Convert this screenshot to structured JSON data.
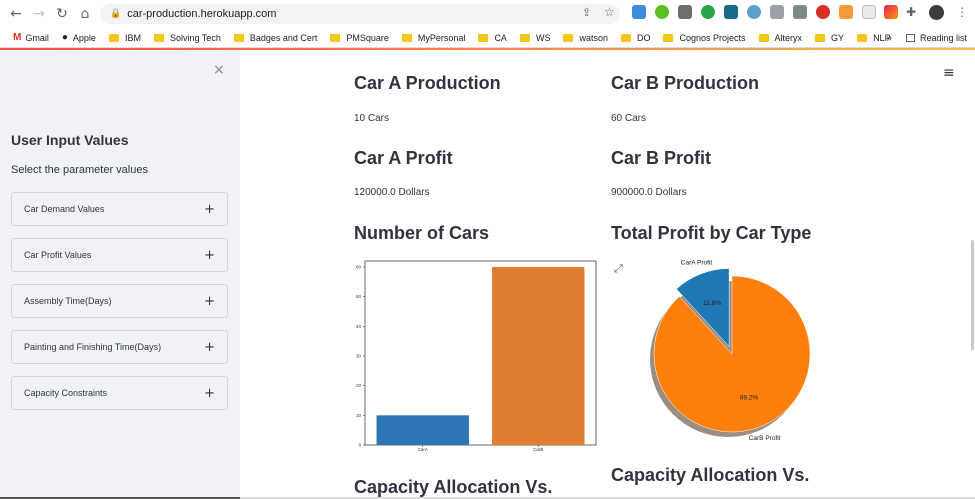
{
  "browser": {
    "url": "car-production.herokuapp.com",
    "bookmarks": [
      "Gmail",
      "Apple",
      "IBM",
      "Solving Tech",
      "Badges and Cert",
      "PMSquare",
      "MyPersonal",
      "CA",
      "WS",
      "watson",
      "DO",
      "Cognos Projects",
      "Alteryx",
      "GY",
      "NLP"
    ],
    "more_label": "»",
    "reading_list": "Reading list"
  },
  "sidebar": {
    "close": "×",
    "title": "User Input Values",
    "subtitle": "Select the parameter values",
    "expanders": [
      {
        "label": "Car Demand Values"
      },
      {
        "label": "Car Profit Values"
      },
      {
        "label": "Assembly Time(Days)"
      },
      {
        "label": "Painting and Finishing Time(Days)"
      },
      {
        "label": "Capacity Constraints"
      }
    ],
    "plus": "+"
  },
  "main": {
    "menu": "≡",
    "car_a_production_title": "Car A Production",
    "car_a_production_value": "10 Cars",
    "car_b_production_title": "Car B Production",
    "car_b_production_value": "60 Cars",
    "car_a_profit_title": "Car A Profit",
    "car_a_profit_value": "120000.0 Dollars",
    "car_b_profit_title": "Car B Profit",
    "car_b_profit_value": "900000.0 Dollars",
    "number_of_cars_title": "Number of Cars",
    "total_profit_title": "Total Profit by Car Type",
    "capacity_left_title": "Capacity Allocation Vs.",
    "capacity_right_title": "Capacity Allocation Vs."
  },
  "chart_data": [
    {
      "type": "bar",
      "categories": [
        "CarA",
        "CarB"
      ],
      "values": [
        10,
        60
      ],
      "colors": [
        "#2e75b6",
        "#e07e2f"
      ],
      "ylim": [
        0,
        62
      ],
      "yticks": [
        0,
        10,
        20,
        30,
        40,
        50,
        60
      ]
    },
    {
      "type": "pie",
      "labels": [
        "CarA Profit",
        "CarB Profit"
      ],
      "values": [
        11.8,
        88.2
      ],
      "pct_labels": [
        "11.8%",
        "88.2%"
      ],
      "colors": [
        "#1f77b4",
        "#ff7f0e"
      ],
      "exploded": "CarA Profit",
      "shadow": true
    }
  ]
}
